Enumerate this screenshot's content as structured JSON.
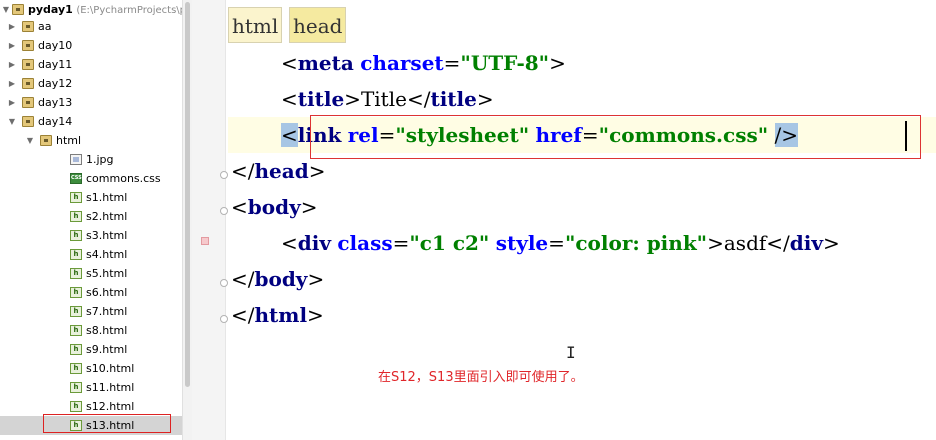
{
  "project_tree": {
    "root": {
      "name": "pyday1",
      "path": "(E:\\PycharmProjects\\p"
    },
    "items": [
      {
        "label": "aa",
        "type": "folder",
        "expanded": false
      },
      {
        "label": "day10",
        "type": "folder",
        "expanded": false
      },
      {
        "label": "day11",
        "type": "folder",
        "expanded": false
      },
      {
        "label": "day12",
        "type": "folder",
        "expanded": false
      },
      {
        "label": "day13",
        "type": "folder",
        "expanded": false
      },
      {
        "label": "day14",
        "type": "folder",
        "expanded": true
      },
      {
        "label": "html",
        "type": "folder",
        "expanded": true
      },
      {
        "label": "1.jpg",
        "type": "image"
      },
      {
        "label": "commons.css",
        "type": "css"
      },
      {
        "label": "s1.html",
        "type": "html"
      },
      {
        "label": "s2.html",
        "type": "html"
      },
      {
        "label": "s3.html",
        "type": "html"
      },
      {
        "label": "s4.html",
        "type": "html"
      },
      {
        "label": "s5.html",
        "type": "html"
      },
      {
        "label": "s6.html",
        "type": "html"
      },
      {
        "label": "s7.html",
        "type": "html"
      },
      {
        "label": "s8.html",
        "type": "html"
      },
      {
        "label": "s9.html",
        "type": "html"
      },
      {
        "label": "s10.html",
        "type": "html"
      },
      {
        "label": "s11.html",
        "type": "html"
      },
      {
        "label": "s12.html",
        "type": "html"
      },
      {
        "label": "s13.html",
        "type": "html",
        "selected": true
      }
    ],
    "icons": {
      "folder": "folder-icon",
      "html": "html-file-icon",
      "css": "css-file-icon",
      "image": "image-file-icon"
    }
  },
  "editor": {
    "breadcrumbs": [
      "html",
      "head"
    ],
    "lines": [
      {
        "indent": 2,
        "tokens": [
          [
            "punct",
            "<"
          ],
          [
            "tag",
            "meta"
          ],
          [
            "punct",
            " "
          ],
          [
            "attr",
            "charset"
          ],
          [
            "punct",
            "="
          ],
          [
            "str",
            "\"UTF-8\""
          ],
          [
            "punct",
            ">"
          ]
        ]
      },
      {
        "indent": 2,
        "tokens": [
          [
            "punct",
            "<"
          ],
          [
            "tag",
            "title"
          ],
          [
            "punct",
            ">"
          ],
          [
            "punct",
            "Title"
          ],
          [
            "punct",
            "</"
          ],
          [
            "tag",
            "title"
          ],
          [
            "punct",
            ">"
          ]
        ]
      },
      {
        "indent": 2,
        "current": true,
        "tokens": [
          [
            "hl",
            "<"
          ],
          [
            "tag",
            "link"
          ],
          [
            "punct",
            " "
          ],
          [
            "attr",
            "rel"
          ],
          [
            "punct",
            "="
          ],
          [
            "str",
            "\"stylesheet\""
          ],
          [
            "punct",
            " "
          ],
          [
            "attr",
            "href"
          ],
          [
            "punct",
            "="
          ],
          [
            "str",
            "\"commons.css\""
          ],
          [
            "punct",
            " "
          ],
          [
            "hl",
            "/>"
          ]
        ]
      },
      {
        "indent": 0,
        "tokens": [
          [
            "punct",
            "</"
          ],
          [
            "tag",
            "head"
          ],
          [
            "punct",
            ">"
          ]
        ]
      },
      {
        "indent": 0,
        "tokens": [
          [
            "punct",
            "<"
          ],
          [
            "tag",
            "body"
          ],
          [
            "punct",
            ">"
          ]
        ]
      },
      {
        "indent": 2,
        "tokens": [
          [
            "punct",
            "<"
          ],
          [
            "tag",
            "div"
          ],
          [
            "punct",
            " "
          ],
          [
            "attr",
            "class"
          ],
          [
            "punct",
            "="
          ],
          [
            "str",
            "\"c1 c2\""
          ],
          [
            "punct",
            " "
          ],
          [
            "attr",
            "style"
          ],
          [
            "punct",
            "="
          ],
          [
            "str",
            "\"color: pink\""
          ],
          [
            "punct",
            ">"
          ],
          [
            "punct",
            "asdf"
          ],
          [
            "punct",
            "</"
          ],
          [
            "tag",
            "div"
          ],
          [
            "punct",
            ">"
          ]
        ]
      },
      {
        "indent": 0,
        "tokens": [
          [
            "punct",
            "</"
          ],
          [
            "tag",
            "body"
          ],
          [
            "punct",
            ">"
          ]
        ]
      },
      {
        "indent": 0,
        "tokens": [
          [
            "punct",
            "</"
          ],
          [
            "tag",
            "html"
          ],
          [
            "punct",
            ">"
          ]
        ]
      }
    ],
    "annotation": "在S12，S13里面引入即可使用了。",
    "cursor_glyph": "I"
  }
}
